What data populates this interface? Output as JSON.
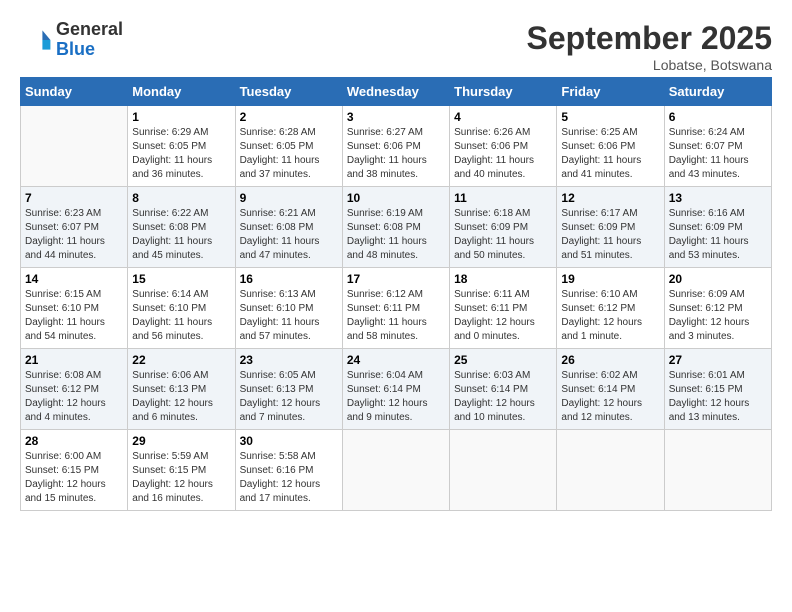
{
  "logo": {
    "general": "General",
    "blue": "Blue"
  },
  "title": "September 2025",
  "location": "Lobatse, Botswana",
  "days_of_week": [
    "Sunday",
    "Monday",
    "Tuesday",
    "Wednesday",
    "Thursday",
    "Friday",
    "Saturday"
  ],
  "weeks": [
    [
      {
        "day": "",
        "info": ""
      },
      {
        "day": "1",
        "info": "Sunrise: 6:29 AM\nSunset: 6:05 PM\nDaylight: 11 hours\nand 36 minutes."
      },
      {
        "day": "2",
        "info": "Sunrise: 6:28 AM\nSunset: 6:05 PM\nDaylight: 11 hours\nand 37 minutes."
      },
      {
        "day": "3",
        "info": "Sunrise: 6:27 AM\nSunset: 6:06 PM\nDaylight: 11 hours\nand 38 minutes."
      },
      {
        "day": "4",
        "info": "Sunrise: 6:26 AM\nSunset: 6:06 PM\nDaylight: 11 hours\nand 40 minutes."
      },
      {
        "day": "5",
        "info": "Sunrise: 6:25 AM\nSunset: 6:06 PM\nDaylight: 11 hours\nand 41 minutes."
      },
      {
        "day": "6",
        "info": "Sunrise: 6:24 AM\nSunset: 6:07 PM\nDaylight: 11 hours\nand 43 minutes."
      }
    ],
    [
      {
        "day": "7",
        "info": "Sunrise: 6:23 AM\nSunset: 6:07 PM\nDaylight: 11 hours\nand 44 minutes."
      },
      {
        "day": "8",
        "info": "Sunrise: 6:22 AM\nSunset: 6:08 PM\nDaylight: 11 hours\nand 45 minutes."
      },
      {
        "day": "9",
        "info": "Sunrise: 6:21 AM\nSunset: 6:08 PM\nDaylight: 11 hours\nand 47 minutes."
      },
      {
        "day": "10",
        "info": "Sunrise: 6:19 AM\nSunset: 6:08 PM\nDaylight: 11 hours\nand 48 minutes."
      },
      {
        "day": "11",
        "info": "Sunrise: 6:18 AM\nSunset: 6:09 PM\nDaylight: 11 hours\nand 50 minutes."
      },
      {
        "day": "12",
        "info": "Sunrise: 6:17 AM\nSunset: 6:09 PM\nDaylight: 11 hours\nand 51 minutes."
      },
      {
        "day": "13",
        "info": "Sunrise: 6:16 AM\nSunset: 6:09 PM\nDaylight: 11 hours\nand 53 minutes."
      }
    ],
    [
      {
        "day": "14",
        "info": "Sunrise: 6:15 AM\nSunset: 6:10 PM\nDaylight: 11 hours\nand 54 minutes."
      },
      {
        "day": "15",
        "info": "Sunrise: 6:14 AM\nSunset: 6:10 PM\nDaylight: 11 hours\nand 56 minutes."
      },
      {
        "day": "16",
        "info": "Sunrise: 6:13 AM\nSunset: 6:10 PM\nDaylight: 11 hours\nand 57 minutes."
      },
      {
        "day": "17",
        "info": "Sunrise: 6:12 AM\nSunset: 6:11 PM\nDaylight: 11 hours\nand 58 minutes."
      },
      {
        "day": "18",
        "info": "Sunrise: 6:11 AM\nSunset: 6:11 PM\nDaylight: 12 hours\nand 0 minutes."
      },
      {
        "day": "19",
        "info": "Sunrise: 6:10 AM\nSunset: 6:12 PM\nDaylight: 12 hours\nand 1 minute."
      },
      {
        "day": "20",
        "info": "Sunrise: 6:09 AM\nSunset: 6:12 PM\nDaylight: 12 hours\nand 3 minutes."
      }
    ],
    [
      {
        "day": "21",
        "info": "Sunrise: 6:08 AM\nSunset: 6:12 PM\nDaylight: 12 hours\nand 4 minutes."
      },
      {
        "day": "22",
        "info": "Sunrise: 6:06 AM\nSunset: 6:13 PM\nDaylight: 12 hours\nand 6 minutes."
      },
      {
        "day": "23",
        "info": "Sunrise: 6:05 AM\nSunset: 6:13 PM\nDaylight: 12 hours\nand 7 minutes."
      },
      {
        "day": "24",
        "info": "Sunrise: 6:04 AM\nSunset: 6:14 PM\nDaylight: 12 hours\nand 9 minutes."
      },
      {
        "day": "25",
        "info": "Sunrise: 6:03 AM\nSunset: 6:14 PM\nDaylight: 12 hours\nand 10 minutes."
      },
      {
        "day": "26",
        "info": "Sunrise: 6:02 AM\nSunset: 6:14 PM\nDaylight: 12 hours\nand 12 minutes."
      },
      {
        "day": "27",
        "info": "Sunrise: 6:01 AM\nSunset: 6:15 PM\nDaylight: 12 hours\nand 13 minutes."
      }
    ],
    [
      {
        "day": "28",
        "info": "Sunrise: 6:00 AM\nSunset: 6:15 PM\nDaylight: 12 hours\nand 15 minutes."
      },
      {
        "day": "29",
        "info": "Sunrise: 5:59 AM\nSunset: 6:15 PM\nDaylight: 12 hours\nand 16 minutes."
      },
      {
        "day": "30",
        "info": "Sunrise: 5:58 AM\nSunset: 6:16 PM\nDaylight: 12 hours\nand 17 minutes."
      },
      {
        "day": "",
        "info": ""
      },
      {
        "day": "",
        "info": ""
      },
      {
        "day": "",
        "info": ""
      },
      {
        "day": "",
        "info": ""
      }
    ]
  ]
}
